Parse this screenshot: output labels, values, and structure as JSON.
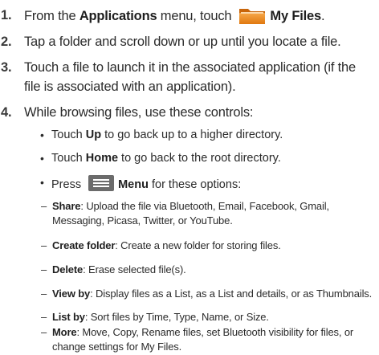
{
  "steps": [
    {
      "num": "1.",
      "pre": "From the ",
      "bold1": "Applications",
      "mid": " menu, touch",
      "bold2": "My Files",
      "post": "."
    },
    {
      "num": "2.",
      "text": "Tap a folder and scroll down or up until you locate a file."
    },
    {
      "num": "3.",
      "line1": "Touch a file to launch it in the associated application (if the",
      "line2": "file is associated with an application)."
    },
    {
      "num": "4.",
      "text": "While browsing files, use these controls:"
    }
  ],
  "bullets": [
    {
      "pre": "Touch ",
      "bold": "Up",
      "post": " to go back up to a higher directory."
    },
    {
      "pre": "Touch ",
      "bold": "Home",
      "post": " to go back to the root directory."
    },
    {
      "pre": "Press ",
      "bold": "Menu",
      "post": " for these options:"
    }
  ],
  "options": [
    {
      "bold": "Share",
      "line1": ": Upload the file via Bluetooth, Email, Facebook, Gmail,",
      "line2": "Messaging, Picasa, Twitter, or YouTube."
    },
    {
      "bold": "Create folder",
      "line1": ": Create a new folder for storing files."
    },
    {
      "bold": "Delete",
      "line1": ": Erase selected file(s)."
    },
    {
      "bold": "View by",
      "line1": ": Display files as a List, as a List and details, or as Thumbnails."
    },
    {
      "bold": "List by",
      "line1": ": Sort files by Time, Type, Name, or Size."
    },
    {
      "bold": "More",
      "line1": ": Move, Copy, Rename files, set Bluetooth visibility for files, or",
      "line2": "change settings for My Files."
    }
  ],
  "colors": {
    "folder_orange": "#f08a1c",
    "menu_gray": "#6b6b6b"
  },
  "icons": {
    "files": "folder-icon",
    "menu": "menu-icon"
  }
}
